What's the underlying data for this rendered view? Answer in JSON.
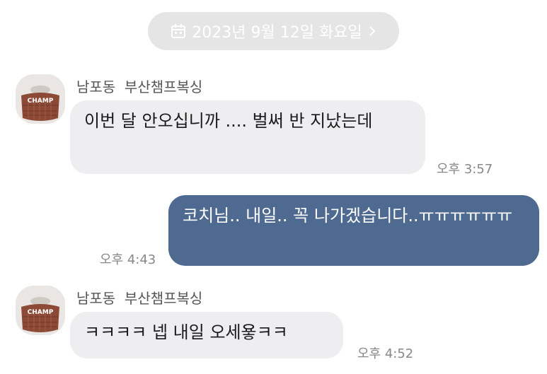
{
  "date_divider": {
    "label": "2023년 9월 12일 화요일",
    "icon": "calendar-icon",
    "chevron": "chevron-right-icon"
  },
  "contact": {
    "name": "남포동  부산챔프복싱",
    "avatar_text": "CHAMP"
  },
  "messages": [
    {
      "direction": "incoming",
      "sender": "남포동  부산챔프복싱",
      "text": "이번 달 안오십니까 .... 벌써 반 지났는데",
      "time": "오후 3:57"
    },
    {
      "direction": "outgoing",
      "text": "코치님.. 내일.. 꼭 나가겠습니다..ㅠㅠㅠㅠㅠㅠ",
      "time": "오후 4:43"
    },
    {
      "direction": "incoming",
      "sender": "남포동  부산챔프복싱",
      "text": "ㅋㅋㅋㅋ 넵 내일 오세욯ㅋㅋ",
      "time": "오후 4:52"
    }
  ],
  "colors": {
    "outgoing_bubble": "#4e6a91",
    "incoming_bubble": "#eeeef0",
    "date_pill": "#e5e5e6"
  }
}
